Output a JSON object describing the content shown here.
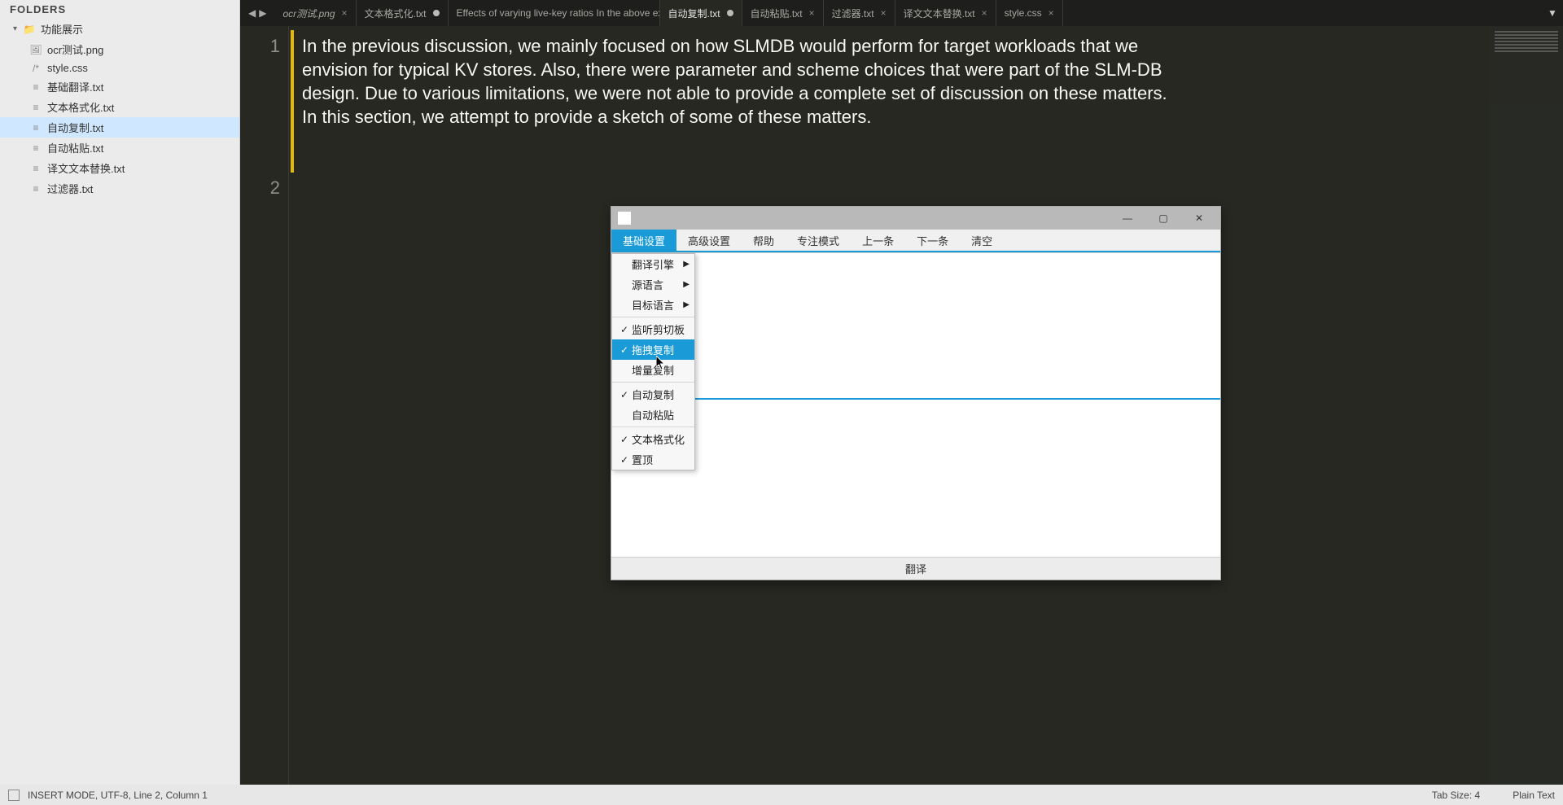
{
  "sidebar": {
    "header": "FOLDERS",
    "root": "功能展示",
    "files": [
      {
        "name": "ocr测试.png",
        "type": "img",
        "active": false
      },
      {
        "name": "style.css",
        "type": "css",
        "active": false
      },
      {
        "name": "基础翻译.txt",
        "type": "txt",
        "active": false
      },
      {
        "name": "文本格式化.txt",
        "type": "txt",
        "active": false
      },
      {
        "name": "自动复制.txt",
        "type": "txt",
        "active": true
      },
      {
        "name": "自动粘贴.txt",
        "type": "txt",
        "active": false
      },
      {
        "name": "译文文本替换.txt",
        "type": "txt",
        "active": false
      },
      {
        "name": "过滤器.txt",
        "type": "txt",
        "active": false
      }
    ]
  },
  "tabs": [
    {
      "label": "ocr测试.png",
      "italic": true,
      "close": "×",
      "dirty": false,
      "active": false
    },
    {
      "label": "文本格式化.txt",
      "italic": false,
      "dirty": true,
      "active": false
    },
    {
      "label": "Effects of varying live-key ratios In the above ex",
      "italic": false,
      "dirty": true,
      "active": false
    },
    {
      "label": "自动复制.txt",
      "italic": false,
      "dirty": true,
      "active": true
    },
    {
      "label": "自动粘贴.txt",
      "italic": false,
      "close": "×",
      "dirty": false,
      "active": false
    },
    {
      "label": "过滤器.txt",
      "italic": false,
      "close": "×",
      "dirty": false,
      "active": false
    },
    {
      "label": "译文文本替换.txt",
      "italic": false,
      "close": "×",
      "dirty": false,
      "active": false
    },
    {
      "label": "style.css",
      "italic": false,
      "close": "×",
      "dirty": false,
      "active": false
    }
  ],
  "nav": {
    "back": "◀",
    "fwd": "▶",
    "chev": "▼"
  },
  "editor": {
    "line_numbers": [
      "1",
      "2"
    ],
    "text": "In the previous discussion, we mainly focused on how SLMDB would perform for target workloads that we envision for typical KV stores. Also, there were parameter and scheme choices that were part of the SLM-DB design. Due to various limitations, we were not able to provide a complete set of discussion on these matters. In this section, we attempt to provide a sketch of some of these matters."
  },
  "statusbar": {
    "left": "INSERT MODE, UTF-8, Line 2, Column 1",
    "tab_size": "Tab Size: 4",
    "syntax": "Plain Text"
  },
  "popup": {
    "menus": [
      "基础设置",
      "高级设置",
      "帮助",
      "专注模式",
      "上一条",
      "下一条",
      "清空"
    ],
    "footer_btn": "翻译",
    "window_btns": {
      "min": "—",
      "max": "▢",
      "close": "✕"
    },
    "dropdown": [
      {
        "text": "翻译引擎",
        "submenu": true
      },
      {
        "text": "源语言",
        "submenu": true
      },
      {
        "text": "目标语言",
        "submenu": true
      },
      {
        "sep": true
      },
      {
        "text": "监听剪切板",
        "checked": true
      },
      {
        "text": "拖拽复制",
        "checked": true,
        "highlight": true
      },
      {
        "text": "增量复制",
        "checked": false
      },
      {
        "sep": true
      },
      {
        "text": "自动复制",
        "checked": true
      },
      {
        "text": "自动粘贴",
        "checked": false
      },
      {
        "sep": true
      },
      {
        "text": "文本格式化",
        "checked": true
      },
      {
        "text": "置顶",
        "checked": true
      }
    ]
  }
}
